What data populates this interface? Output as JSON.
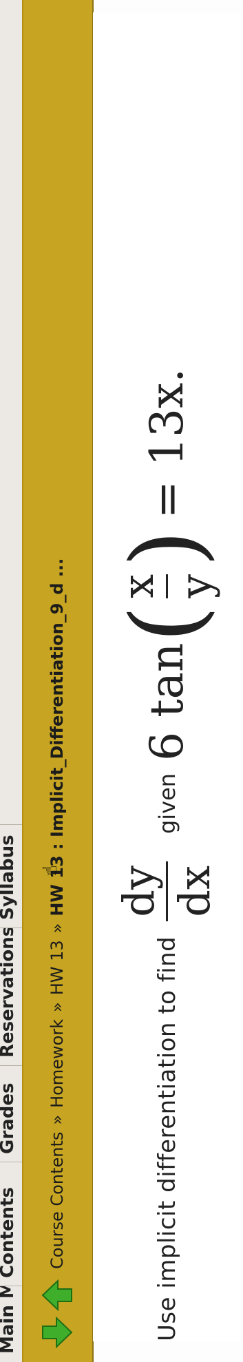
{
  "tabs": [
    {
      "label": "Main Menu"
    },
    {
      "label": "Contents"
    },
    {
      "label": "Grades"
    },
    {
      "label": "Reservations"
    },
    {
      "label": "Syllabus"
    }
  ],
  "breadcrumb": {
    "items": [
      "Course Contents",
      "Homework",
      "HW 13"
    ],
    "current": "HW 13 : Implicit_Differentiation_9_d ...",
    "separator": "»"
  },
  "question": {
    "intro": "Use implicit differentiation to find",
    "derivative": {
      "numerator": "dy",
      "denominator": "dx"
    },
    "given": "given",
    "coefficient": "6 tan",
    "inner": {
      "numerator": "x",
      "denominator": "y"
    },
    "rhs": "= 13x."
  },
  "colors": {
    "nav_bar": "#c7a523",
    "arrow_green": "#3fae2a"
  },
  "icons": [
    "arrow-down-icon",
    "arrow-up-icon",
    "hand-cursor-icon"
  ]
}
